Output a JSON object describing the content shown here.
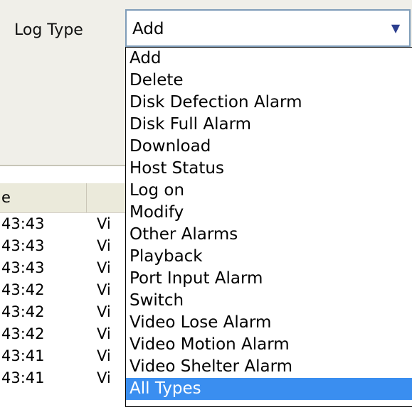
{
  "filter": {
    "log_type_label": "Log Type",
    "selected_value": "Add",
    "arrow_icon": "dropdown-arrow-icon"
  },
  "dropdown": {
    "options": [
      "Add",
      "Delete",
      "Disk Defection Alarm",
      "Disk Full Alarm",
      "Download",
      "Host Status",
      "Log on",
      "Modify",
      "Other Alarms",
      "Playback",
      "Port Input Alarm",
      "Switch",
      "Video Lose Alarm",
      "Video Motion Alarm",
      "Video Shelter Alarm",
      "All Types"
    ],
    "highlighted": "All Types",
    "highlight_color": "#3a8ef0"
  },
  "table": {
    "column_time_header": "e",
    "rows": [
      {
        "time": "43:43",
        "type": "Vi"
      },
      {
        "time": "43:43",
        "type": "Vi"
      },
      {
        "time": "43:43",
        "type": "Vi"
      },
      {
        "time": "43:42",
        "type": "Vi"
      },
      {
        "time": "43:42",
        "type": "Vi"
      },
      {
        "time": "43:42",
        "type": "Vi"
      },
      {
        "time": "43:41",
        "type": "Vi"
      },
      {
        "time": "43:41",
        "type": "Vi"
      }
    ]
  }
}
